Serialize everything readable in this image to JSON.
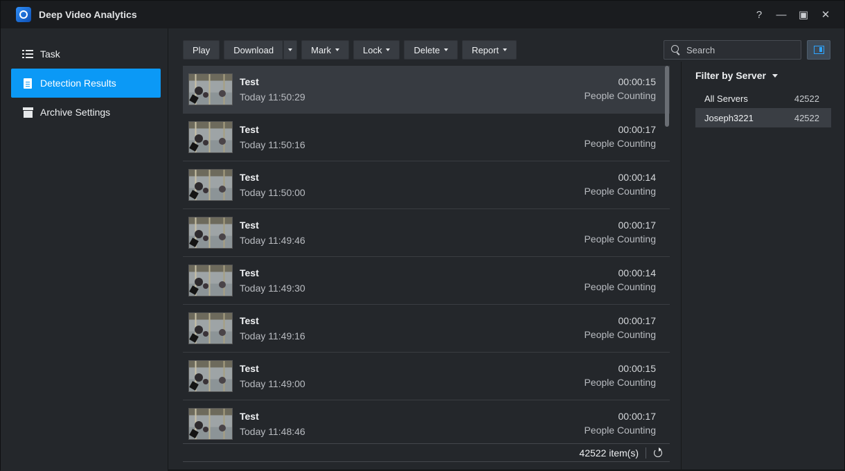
{
  "app": {
    "title": "Deep Video Analytics"
  },
  "window_controls": {
    "help": "?",
    "minimize": "—",
    "maximize": "▣",
    "close": "✕"
  },
  "sidebar": {
    "items": [
      {
        "label": "Task",
        "icon": "list-icon"
      },
      {
        "label": "Detection Results",
        "icon": "document-icon",
        "active": true
      },
      {
        "label": "Archive Settings",
        "icon": "archive-icon"
      }
    ]
  },
  "toolbar": {
    "play": "Play",
    "download": "Download",
    "mark": "Mark",
    "lock": "Lock",
    "delete": "Delete",
    "report": "Report"
  },
  "search": {
    "placeholder": "Search"
  },
  "results": [
    {
      "title": "Test",
      "time": "Today 11:50:29",
      "duration": "00:00:15",
      "type": "People Counting",
      "selected": true
    },
    {
      "title": "Test",
      "time": "Today 11:50:16",
      "duration": "00:00:17",
      "type": "People Counting"
    },
    {
      "title": "Test",
      "time": "Today 11:50:00",
      "duration": "00:00:14",
      "type": "People Counting"
    },
    {
      "title": "Test",
      "time": "Today 11:49:46",
      "duration": "00:00:17",
      "type": "People Counting"
    },
    {
      "title": "Test",
      "time": "Today 11:49:30",
      "duration": "00:00:14",
      "type": "People Counting"
    },
    {
      "title": "Test",
      "time": "Today 11:49:16",
      "duration": "00:00:17",
      "type": "People Counting"
    },
    {
      "title": "Test",
      "time": "Today 11:49:00",
      "duration": "00:00:15",
      "type": "People Counting"
    },
    {
      "title": "Test",
      "time": "Today 11:48:46",
      "duration": "00:00:17",
      "type": "People Counting"
    }
  ],
  "footer": {
    "count": "42522 item(s)"
  },
  "filter": {
    "heading": "Filter by Server",
    "servers": [
      {
        "name": "All Servers",
        "count": "42522"
      },
      {
        "name": "Joseph3221",
        "count": "42522",
        "selected": true
      }
    ]
  },
  "colors": {
    "accent": "#0b99f6",
    "background": "#24272b",
    "titlebar": "#1a1c1f",
    "selected_row": "#373b41"
  }
}
